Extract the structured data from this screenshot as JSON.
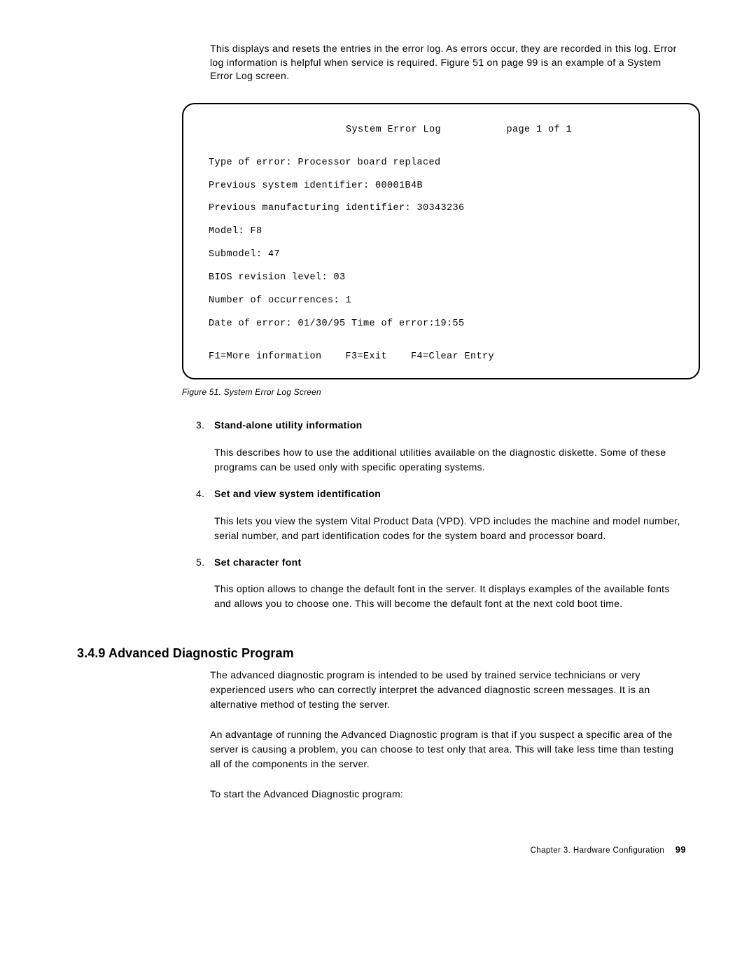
{
  "intro": "This displays and resets the entries in the error log.  As errors occur, they are recorded in this log.  Error log information is helpful when service is required.  Figure 51 on page 99 is an example of a System Error Log screen.",
  "screen": {
    "title_row": "      System Error Log           page 1 of 1",
    "lines": [
      "Type of error: Processor board replaced",
      "Previous system identifier: 00001B4B",
      "Previous manufacturing identifier: 30343236",
      "Model: F8",
      "Submodel: 47",
      "BIOS revision level: 03",
      "Number of occurrences: 1",
      "Date of error: 01/30/95  Time of error:19:55"
    ],
    "bottom": "F1=More information    F3=Exit    F4=Clear Entry"
  },
  "figure_caption": "Figure  51.  System Error Log Screen",
  "items": [
    {
      "num": "3.",
      "title": "Stand-alone utility information",
      "desc": "This describes how to use the additional utilities available on the diagnostic diskette.  Some of these programs can be used only with specific operating systems."
    },
    {
      "num": "4.",
      "title": "Set and view system identification",
      "desc": "This lets you view the system Vital Product Data (VPD).  VPD includes the machine and model number, serial number, and part identification codes for the system board and processor board."
    },
    {
      "num": "5.",
      "title": "Set character font",
      "desc": "This option allows to change the default font in the server.  It displays examples of the available fonts and allows you to choose one.  This will become the default font at the next cold boot time."
    }
  ],
  "section": {
    "heading": "3.4.9  Advanced Diagnostic Program",
    "para1": "The advanced diagnostic program is intended to be used by trained service technicians or very experienced users who can correctly interpret the advanced diagnostic screen messages. It is an alternative method of testing the server.",
    "para2": "An advantage of running the Advanced Diagnostic program is that if you suspect a specific area of the server is causing a problem, you can choose to test only that area. This will take less time than testing all of the components in the server.",
    "para3": "To start the Advanced Diagnostic program:"
  },
  "footer": {
    "text": "Chapter 3.  Hardware Configuration",
    "page": "99"
  }
}
